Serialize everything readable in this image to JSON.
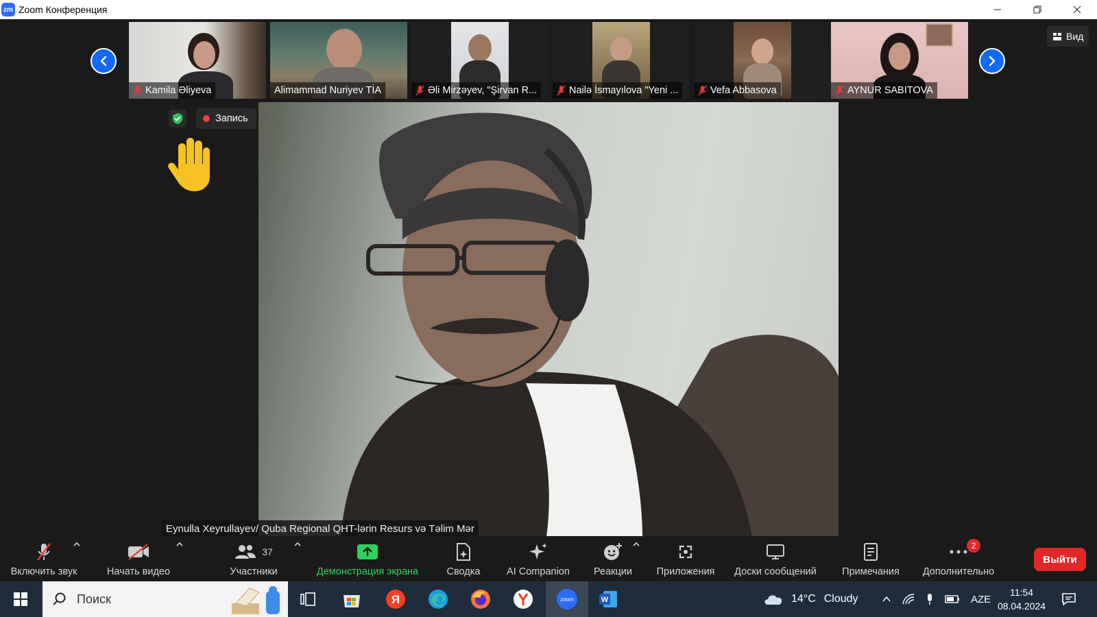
{
  "window": {
    "title": "Zoom Конференция",
    "app_logo": "zm"
  },
  "participants": [
    {
      "name": "Kamila Əliyeva",
      "muted": true
    },
    {
      "name": "Alimammad Nuriyev TİA",
      "muted": false
    },
    {
      "name": "Əli Mirzəyev, \"Şirvan R...",
      "muted": true
    },
    {
      "name": "Nailə İsmayılova \"Yeni ...",
      "muted": true
    },
    {
      "name": "Vefa Abbasova",
      "muted": true
    },
    {
      "name": "AYNUR SABITOVA",
      "muted": true
    }
  ],
  "status": {
    "recording_label": "Запись"
  },
  "view_button_label": "Вид",
  "active_speaker": {
    "label": "Eynulla Xeyrullayev/ Quba Regional QHT-lərin Resurs və Təlim Mər"
  },
  "toolbar": {
    "unmute_label": "Включить звук",
    "start_video_label": "Начать видео",
    "participants_label": "Участники",
    "participants_count": "37",
    "share_screen_label": "Демонстрация экрана",
    "summary_label": "Сводка",
    "ai_companion_label": "AI Companion",
    "reactions_label": "Реакции",
    "apps_label": "Приложения",
    "whiteboards_label": "Доски сообщений",
    "notes_label": "Примечания",
    "more_label": "Дополнительно",
    "more_badge": "2",
    "leave_label": "Выйти"
  },
  "taskbar": {
    "search_placeholder": "Поиск",
    "weather_temp": "14°C",
    "weather_text": "Cloudy",
    "language": "AZE",
    "time": "11:54",
    "date": "08.04.2024"
  },
  "colors": {
    "accent_blue": "#1268ff",
    "leave_red": "#e02828",
    "share_green": "#2fd25f",
    "muted_red": "#e23c3c"
  }
}
